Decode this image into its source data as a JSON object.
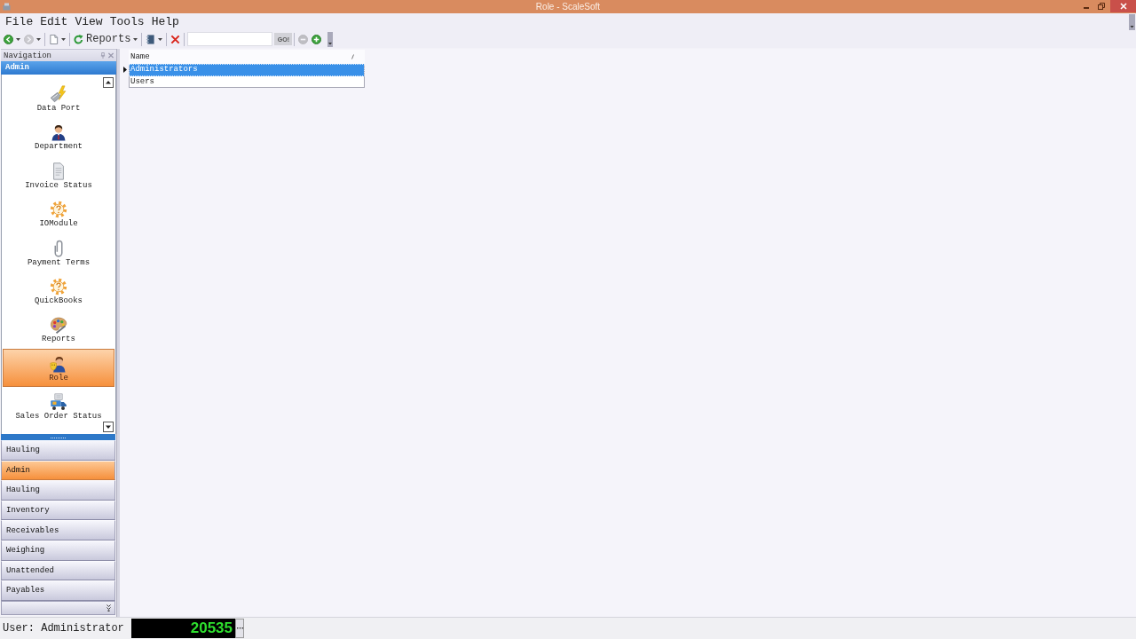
{
  "window": {
    "title": "Role - ScaleSoft"
  },
  "menu": [
    {
      "label": "File"
    },
    {
      "label": "Edit"
    },
    {
      "label": "View"
    },
    {
      "label": "Tools"
    },
    {
      "label": "Help"
    }
  ],
  "toolbar": {
    "groups": [
      [
        {
          "kind": "back",
          "disabled": false,
          "dropdown": true
        },
        {
          "kind": "forward",
          "disabled": true,
          "dropdown": true
        }
      ],
      [
        {
          "kind": "new",
          "disabled": false,
          "dropdown": true
        }
      ],
      [
        {
          "kind": "refresh",
          "label": "Reports",
          "disabled": false,
          "dropdown": true
        }
      ],
      [
        {
          "kind": "notebook",
          "disabled": false,
          "dropdown": true
        }
      ],
      [
        {
          "kind": "delete",
          "disabled": false,
          "dropdown": false
        }
      ],
      [
        {
          "kind": "search",
          "disabled": false
        },
        {
          "kind": "go",
          "label": "GO!",
          "disabled": false
        }
      ],
      [
        {
          "kind": "remove",
          "disabled": true,
          "dropdown": false
        },
        {
          "kind": "add",
          "disabled": false,
          "dropdown": false
        }
      ]
    ]
  },
  "navigation": {
    "title": "Navigation",
    "group_title": "Admin",
    "items": [
      {
        "label": "Data Port",
        "kind": "plug",
        "selected": false
      },
      {
        "label": "Department",
        "kind": "person",
        "selected": false
      },
      {
        "label": "Invoice Status",
        "kind": "document",
        "selected": false
      },
      {
        "label": "IOModule",
        "kind": "gear",
        "selected": false
      },
      {
        "label": "Payment Terms",
        "kind": "clip",
        "selected": false
      },
      {
        "label": "QuickBooks",
        "kind": "gear",
        "selected": false
      },
      {
        "label": "Reports",
        "kind": "palette",
        "selected": false
      },
      {
        "label": "Role",
        "kind": "masked",
        "selected": true
      },
      {
        "label": "Sales Order Status",
        "kind": "truck",
        "selected": false
      }
    ],
    "groups": [
      {
        "label": "Hauling",
        "selected": false
      },
      {
        "label": "Admin",
        "selected": true
      },
      {
        "label": "Hauling",
        "selected": false
      },
      {
        "label": "Inventory",
        "selected": false
      },
      {
        "label": "Receivables",
        "selected": false
      },
      {
        "label": "Weighing",
        "selected": false
      },
      {
        "label": "Unattended",
        "selected": false
      },
      {
        "label": "Payables",
        "selected": false
      }
    ]
  },
  "grid": {
    "columns": [
      {
        "label": "Name",
        "sorted": true
      }
    ],
    "rows": [
      {
        "cells": [
          "Administrators"
        ],
        "selected": true
      },
      {
        "cells": [
          "Users"
        ],
        "selected": false
      }
    ]
  },
  "status_bar": {
    "user": "User: Administrator",
    "counter": "20535"
  }
}
